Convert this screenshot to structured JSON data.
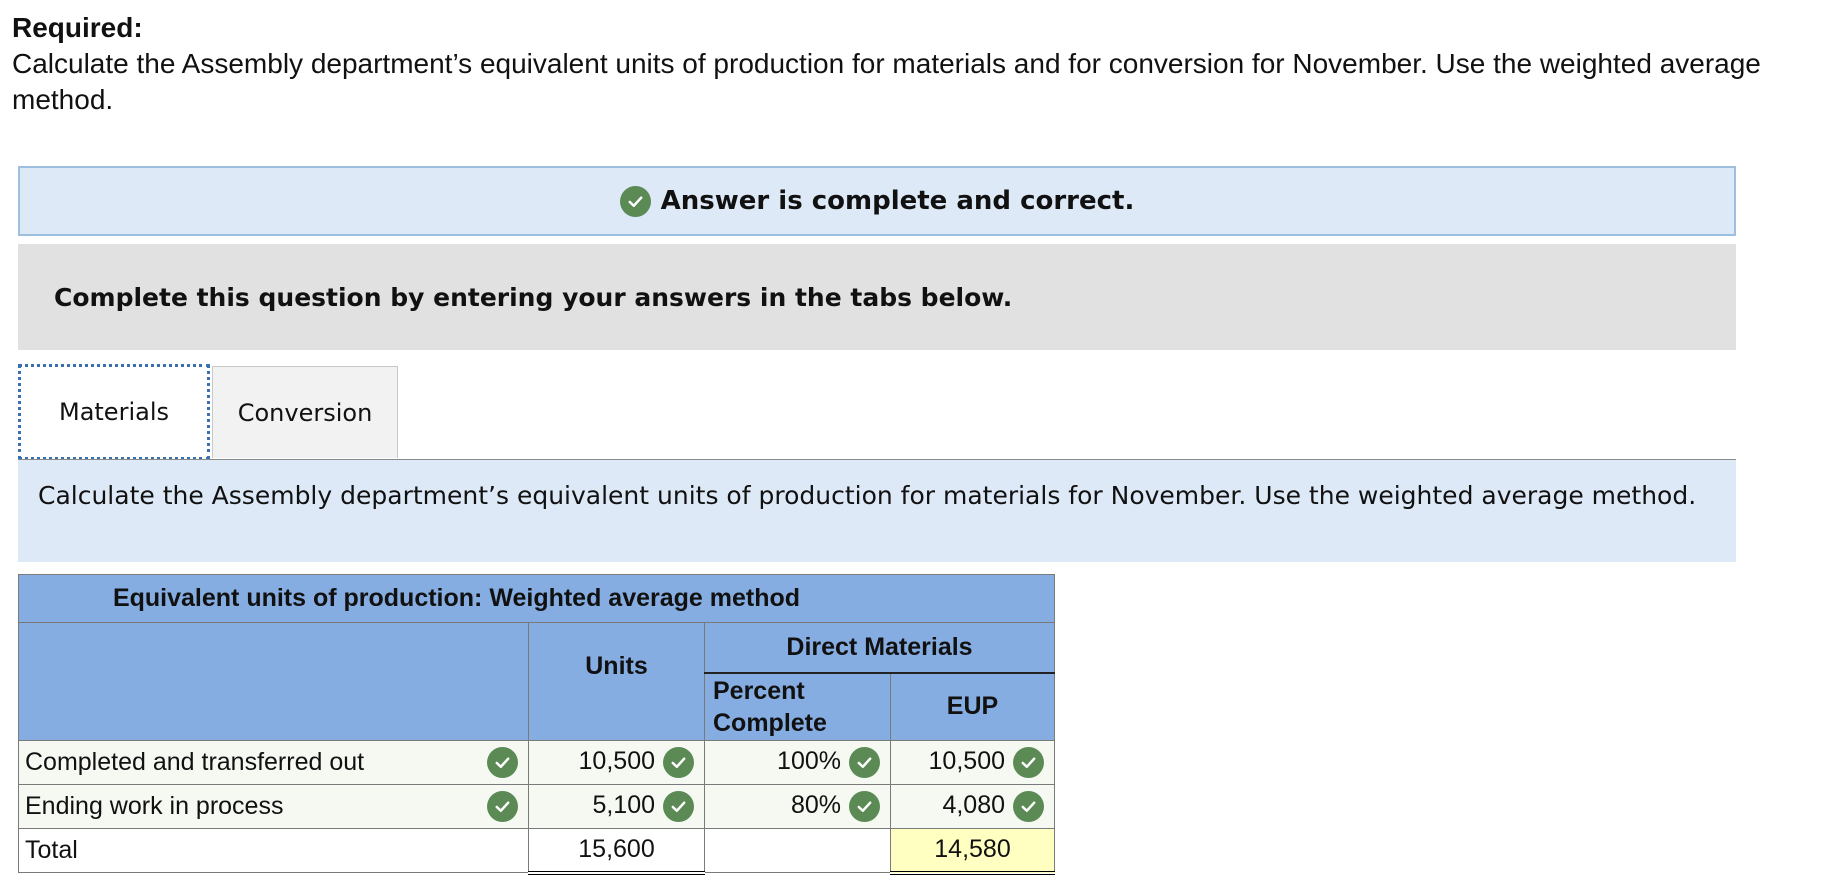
{
  "required": {
    "title": "Required:",
    "text": "Calculate the Assembly department’s equivalent units of production for materials and for conversion for November. Use the weighted average method."
  },
  "banner": {
    "message": "Answer is complete and correct."
  },
  "instructions": "Complete this question by entering your answers in the tabs below.",
  "tabs": [
    {
      "label": "Materials",
      "active": true
    },
    {
      "label": "Conversion",
      "active": false
    }
  ],
  "description": "Calculate the Assembly department’s equivalent units of production for materials for November. Use the weighted average method.",
  "table": {
    "title": "Equivalent units of production: Weighted average method",
    "col_units": "Units",
    "group_header": "Direct Materials",
    "col_percent": "Percent Complete",
    "col_eup": "EUP",
    "rows": [
      {
        "label": "Completed and transferred out",
        "units": "10,500",
        "percent": "100%",
        "eup": "10,500"
      },
      {
        "label": "Ending work in process",
        "units": "5,100",
        "percent": "80%",
        "eup": "4,080"
      }
    ],
    "total": {
      "label": "Total",
      "units": "15,600",
      "eup": "14,580"
    }
  },
  "colors": {
    "check": "#5b8a55",
    "header": "#86ade2",
    "banner": "#dde9f7",
    "total_highlight": "#ffffc2"
  },
  "icons": {
    "correct": "check-circle-icon"
  }
}
